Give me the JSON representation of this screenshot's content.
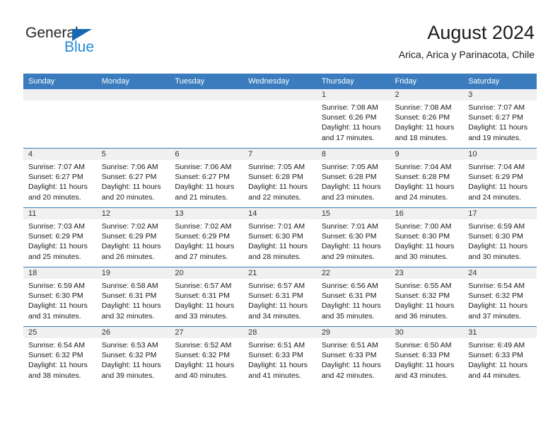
{
  "brand": {
    "name_dark": "General",
    "name_light": "Blue",
    "accent_color": "#2389d4",
    "triangle_color": "#1668b3"
  },
  "header": {
    "title": "August 2024",
    "subtitle": "Arica, Arica y Parinacota, Chile",
    "header_bg_color": "#3a7cbe",
    "daynum_bg_color": "#f0f0f0"
  },
  "weekdays": [
    "Sunday",
    "Monday",
    "Tuesday",
    "Wednesday",
    "Thursday",
    "Friday",
    "Saturday"
  ],
  "weeks": [
    [
      {
        "day": "",
        "sunrise": "",
        "sunset": "",
        "daylight1": "",
        "daylight2": ""
      },
      {
        "day": "",
        "sunrise": "",
        "sunset": "",
        "daylight1": "",
        "daylight2": ""
      },
      {
        "day": "",
        "sunrise": "",
        "sunset": "",
        "daylight1": "",
        "daylight2": ""
      },
      {
        "day": "",
        "sunrise": "",
        "sunset": "",
        "daylight1": "",
        "daylight2": ""
      },
      {
        "day": "1",
        "sunrise": "Sunrise: 7:08 AM",
        "sunset": "Sunset: 6:26 PM",
        "daylight1": "Daylight: 11 hours",
        "daylight2": "and 17 minutes."
      },
      {
        "day": "2",
        "sunrise": "Sunrise: 7:08 AM",
        "sunset": "Sunset: 6:26 PM",
        "daylight1": "Daylight: 11 hours",
        "daylight2": "and 18 minutes."
      },
      {
        "day": "3",
        "sunrise": "Sunrise: 7:07 AM",
        "sunset": "Sunset: 6:27 PM",
        "daylight1": "Daylight: 11 hours",
        "daylight2": "and 19 minutes."
      }
    ],
    [
      {
        "day": "4",
        "sunrise": "Sunrise: 7:07 AM",
        "sunset": "Sunset: 6:27 PM",
        "daylight1": "Daylight: 11 hours",
        "daylight2": "and 20 minutes."
      },
      {
        "day": "5",
        "sunrise": "Sunrise: 7:06 AM",
        "sunset": "Sunset: 6:27 PM",
        "daylight1": "Daylight: 11 hours",
        "daylight2": "and 20 minutes."
      },
      {
        "day": "6",
        "sunrise": "Sunrise: 7:06 AM",
        "sunset": "Sunset: 6:27 PM",
        "daylight1": "Daylight: 11 hours",
        "daylight2": "and 21 minutes."
      },
      {
        "day": "7",
        "sunrise": "Sunrise: 7:05 AM",
        "sunset": "Sunset: 6:28 PM",
        "daylight1": "Daylight: 11 hours",
        "daylight2": "and 22 minutes."
      },
      {
        "day": "8",
        "sunrise": "Sunrise: 7:05 AM",
        "sunset": "Sunset: 6:28 PM",
        "daylight1": "Daylight: 11 hours",
        "daylight2": "and 23 minutes."
      },
      {
        "day": "9",
        "sunrise": "Sunrise: 7:04 AM",
        "sunset": "Sunset: 6:28 PM",
        "daylight1": "Daylight: 11 hours",
        "daylight2": "and 24 minutes."
      },
      {
        "day": "10",
        "sunrise": "Sunrise: 7:04 AM",
        "sunset": "Sunset: 6:29 PM",
        "daylight1": "Daylight: 11 hours",
        "daylight2": "and 24 minutes."
      }
    ],
    [
      {
        "day": "11",
        "sunrise": "Sunrise: 7:03 AM",
        "sunset": "Sunset: 6:29 PM",
        "daylight1": "Daylight: 11 hours",
        "daylight2": "and 25 minutes."
      },
      {
        "day": "12",
        "sunrise": "Sunrise: 7:02 AM",
        "sunset": "Sunset: 6:29 PM",
        "daylight1": "Daylight: 11 hours",
        "daylight2": "and 26 minutes."
      },
      {
        "day": "13",
        "sunrise": "Sunrise: 7:02 AM",
        "sunset": "Sunset: 6:29 PM",
        "daylight1": "Daylight: 11 hours",
        "daylight2": "and 27 minutes."
      },
      {
        "day": "14",
        "sunrise": "Sunrise: 7:01 AM",
        "sunset": "Sunset: 6:30 PM",
        "daylight1": "Daylight: 11 hours",
        "daylight2": "and 28 minutes."
      },
      {
        "day": "15",
        "sunrise": "Sunrise: 7:01 AM",
        "sunset": "Sunset: 6:30 PM",
        "daylight1": "Daylight: 11 hours",
        "daylight2": "and 29 minutes."
      },
      {
        "day": "16",
        "sunrise": "Sunrise: 7:00 AM",
        "sunset": "Sunset: 6:30 PM",
        "daylight1": "Daylight: 11 hours",
        "daylight2": "and 30 minutes."
      },
      {
        "day": "17",
        "sunrise": "Sunrise: 6:59 AM",
        "sunset": "Sunset: 6:30 PM",
        "daylight1": "Daylight: 11 hours",
        "daylight2": "and 30 minutes."
      }
    ],
    [
      {
        "day": "18",
        "sunrise": "Sunrise: 6:59 AM",
        "sunset": "Sunset: 6:30 PM",
        "daylight1": "Daylight: 11 hours",
        "daylight2": "and 31 minutes."
      },
      {
        "day": "19",
        "sunrise": "Sunrise: 6:58 AM",
        "sunset": "Sunset: 6:31 PM",
        "daylight1": "Daylight: 11 hours",
        "daylight2": "and 32 minutes."
      },
      {
        "day": "20",
        "sunrise": "Sunrise: 6:57 AM",
        "sunset": "Sunset: 6:31 PM",
        "daylight1": "Daylight: 11 hours",
        "daylight2": "and 33 minutes."
      },
      {
        "day": "21",
        "sunrise": "Sunrise: 6:57 AM",
        "sunset": "Sunset: 6:31 PM",
        "daylight1": "Daylight: 11 hours",
        "daylight2": "and 34 minutes."
      },
      {
        "day": "22",
        "sunrise": "Sunrise: 6:56 AM",
        "sunset": "Sunset: 6:31 PM",
        "daylight1": "Daylight: 11 hours",
        "daylight2": "and 35 minutes."
      },
      {
        "day": "23",
        "sunrise": "Sunrise: 6:55 AM",
        "sunset": "Sunset: 6:32 PM",
        "daylight1": "Daylight: 11 hours",
        "daylight2": "and 36 minutes."
      },
      {
        "day": "24",
        "sunrise": "Sunrise: 6:54 AM",
        "sunset": "Sunset: 6:32 PM",
        "daylight1": "Daylight: 11 hours",
        "daylight2": "and 37 minutes."
      }
    ],
    [
      {
        "day": "25",
        "sunrise": "Sunrise: 6:54 AM",
        "sunset": "Sunset: 6:32 PM",
        "daylight1": "Daylight: 11 hours",
        "daylight2": "and 38 minutes."
      },
      {
        "day": "26",
        "sunrise": "Sunrise: 6:53 AM",
        "sunset": "Sunset: 6:32 PM",
        "daylight1": "Daylight: 11 hours",
        "daylight2": "and 39 minutes."
      },
      {
        "day": "27",
        "sunrise": "Sunrise: 6:52 AM",
        "sunset": "Sunset: 6:32 PM",
        "daylight1": "Daylight: 11 hours",
        "daylight2": "and 40 minutes."
      },
      {
        "day": "28",
        "sunrise": "Sunrise: 6:51 AM",
        "sunset": "Sunset: 6:33 PM",
        "daylight1": "Daylight: 11 hours",
        "daylight2": "and 41 minutes."
      },
      {
        "day": "29",
        "sunrise": "Sunrise: 6:51 AM",
        "sunset": "Sunset: 6:33 PM",
        "daylight1": "Daylight: 11 hours",
        "daylight2": "and 42 minutes."
      },
      {
        "day": "30",
        "sunrise": "Sunrise: 6:50 AM",
        "sunset": "Sunset: 6:33 PM",
        "daylight1": "Daylight: 11 hours",
        "daylight2": "and 43 minutes."
      },
      {
        "day": "31",
        "sunrise": "Sunrise: 6:49 AM",
        "sunset": "Sunset: 6:33 PM",
        "daylight1": "Daylight: 11 hours",
        "daylight2": "and 44 minutes."
      }
    ]
  ]
}
